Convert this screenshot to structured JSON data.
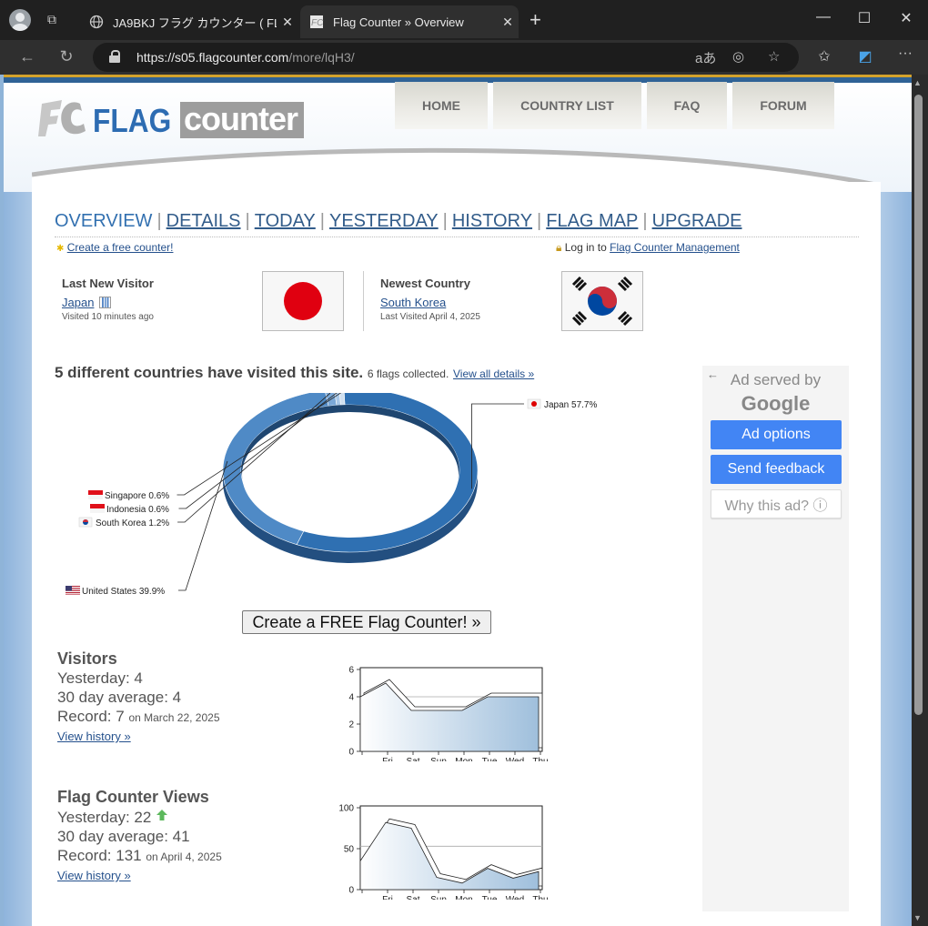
{
  "browser": {
    "tabs": [
      {
        "title": "JA9BKJ フラグ カウンター ( FLAG counter )",
        "icon": "globe-icon"
      },
      {
        "title": "Flag Counter » Overview",
        "icon": "flagcounter-favicon"
      }
    ],
    "url_host": "https://s05.flagcounter.com",
    "url_path": "/more/lqH3/"
  },
  "site": {
    "logo_fc": "FC",
    "logo_flag": "FLAG",
    "logo_counter": "counter",
    "nav": [
      "HOME",
      "COUNTRY LIST",
      "FAQ",
      "FORUM"
    ],
    "subnav": [
      "OVERVIEW",
      "DETAILS",
      "TODAY",
      "YESTERDAY",
      "HISTORY",
      "FLAG MAP",
      "UPGRADE"
    ],
    "create_free": "Create a free counter!",
    "login_prefix": "Log in to",
    "login_link": "Flag Counter Management"
  },
  "last_visitor": {
    "label": "Last New Visitor",
    "country": "Japan",
    "visited": "Visited 10 minutes ago"
  },
  "newest_country": {
    "label": "Newest Country",
    "country": "South Korea",
    "visited": "Last Visited April 4, 2025"
  },
  "summary": {
    "headline": "5 different countries have visited this site.",
    "flags": "6 flags collected.",
    "details_link": "View all details »"
  },
  "pie": {
    "type": "pie",
    "slices": [
      {
        "name": "Japan",
        "pct": "57.7%",
        "value": 57.7,
        "color": "#2f70b2"
      },
      {
        "name": "United States",
        "pct": "39.9%",
        "value": 39.9,
        "color": "#4f8ac6"
      },
      {
        "name": "South Korea",
        "pct": "1.2%",
        "value": 1.2,
        "color": "#7aa8d8"
      },
      {
        "name": "Indonesia",
        "pct": "0.6%",
        "value": 0.6,
        "color": "#a9c8e8"
      },
      {
        "name": "Singapore",
        "pct": "0.6%",
        "value": 0.6,
        "color": "#d0e0f0"
      }
    ]
  },
  "create_button": "Create a FREE Flag Counter! »",
  "visitors": {
    "title": "Visitors",
    "yesterday": "Yesterday: 4",
    "avg": "30 day average: 4",
    "record": "Record: 7",
    "record_date": "on March 22, 2025",
    "history": "View history »"
  },
  "views": {
    "title": "Flag Counter Views",
    "yesterday": "Yesterday: 22",
    "avg": "30 day average: 41",
    "record": "Record: 131",
    "record_date": "on April 4, 2025",
    "history": "View history »"
  },
  "chart_data": [
    {
      "type": "area",
      "title": "",
      "x": [
        "",
        "Fri",
        "Sat",
        "Sun",
        "Mon",
        "Tue",
        "Wed",
        "Thu"
      ],
      "values": [
        4,
        5,
        3,
        3,
        3,
        4,
        4,
        4
      ],
      "average": 4,
      "ylim": [
        0,
        6
      ],
      "yticks": [
        "6",
        "4",
        "2",
        "0"
      ]
    },
    {
      "type": "area",
      "title": "",
      "x": [
        "",
        "Fri",
        "Sat",
        "Sun",
        "Mon",
        "Tue",
        "Wed",
        "Thu"
      ],
      "values": [
        35,
        82,
        75,
        15,
        8,
        26,
        14,
        22
      ],
      "average": 53,
      "ylim": [
        0,
        100
      ],
      "yticks": [
        "100",
        "50",
        "0"
      ]
    }
  ],
  "ad": {
    "served_by": "Ad served by",
    "google": "Google",
    "options": "Ad options",
    "feedback": "Send feedback",
    "why": "Why this ad? ⓘ"
  }
}
